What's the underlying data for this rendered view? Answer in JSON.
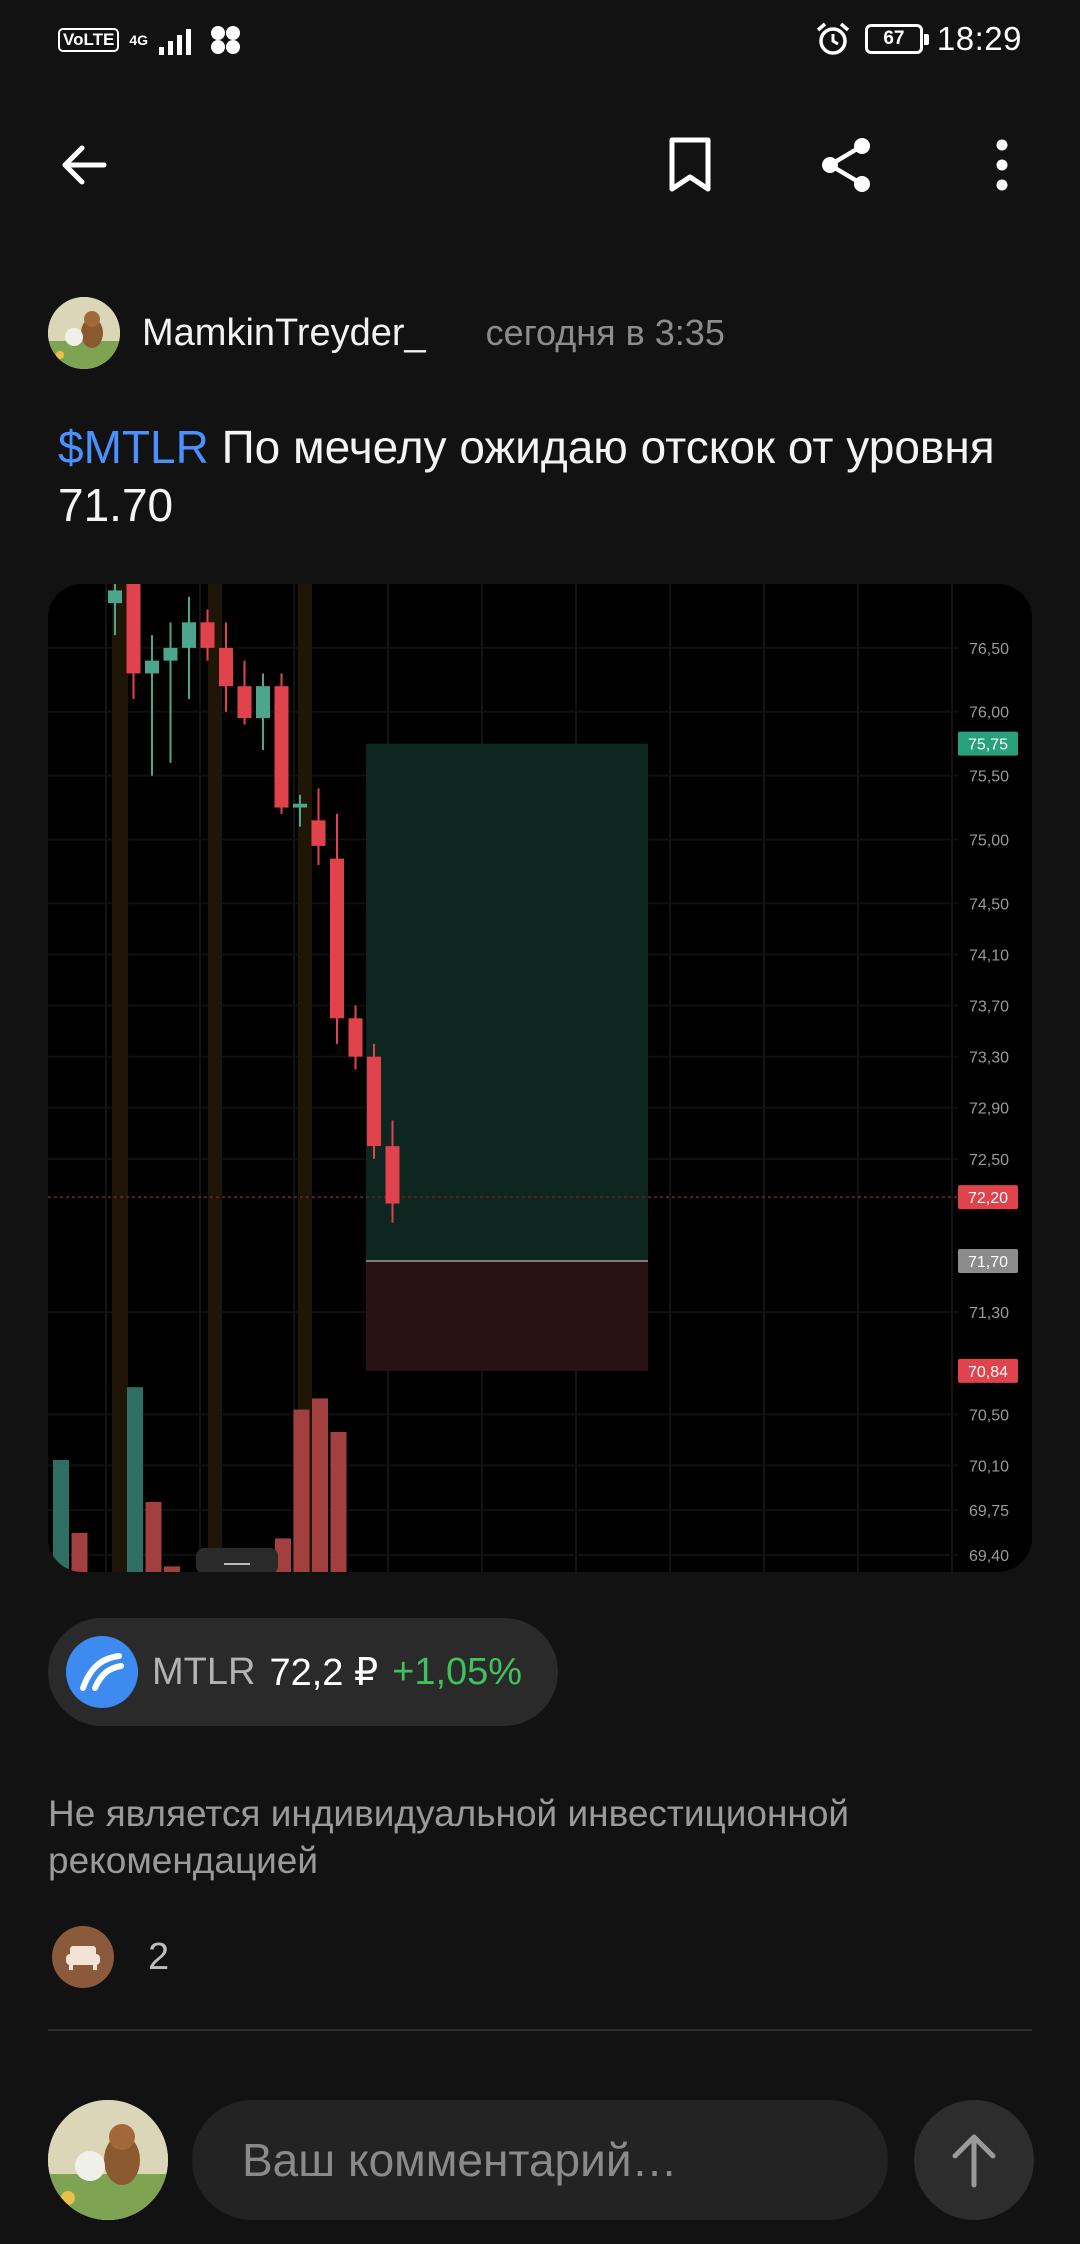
{
  "status_bar": {
    "volte": "VoLTE",
    "network": "4G",
    "battery": "67",
    "time": "18:29"
  },
  "icons": {
    "back": "arrow-left-icon",
    "bookmark": "bookmark-icon",
    "share": "share-icon",
    "more": "more-vertical-icon",
    "send": "arrow-up-icon"
  },
  "post": {
    "author": "MamkinTreyder_",
    "time": "сегодня в 3:35",
    "ticker_link": "$MTLR",
    "text": " По мечелу ожидаю отскок от уровня 71.70",
    "disclaimer": "Не является индивидуальной инвестиционной рекомендацией",
    "reaction_count": "2"
  },
  "instrument": {
    "ticker": "MTLR",
    "price": "72,2 ₽",
    "change": "+1,05%",
    "change_color": "#3fc15c"
  },
  "chart_data": {
    "type": "candlestick",
    "ylim": [
      69.25,
      77.0
    ],
    "y_ticks": [
      "76,50",
      "76,00",
      "75,50",
      "75,00",
      "74,50",
      "74,10",
      "73,70",
      "73,30",
      "72,90",
      "72,50",
      "71,30",
      "70,50",
      "70,10",
      "69,75",
      "69,40"
    ],
    "price_tags": [
      {
        "label": "75,75",
        "value": 75.75,
        "color": "#26a17b"
      },
      {
        "label": "72,20",
        "value": 72.2,
        "color": "#e0434b"
      },
      {
        "label": "71,70",
        "value": 71.7,
        "color": "#8c8c8c"
      },
      {
        "label": "70,84",
        "value": 70.84,
        "color": "#e0434b"
      }
    ],
    "candles": [
      {
        "o": 76.85,
        "h": 77.0,
        "l": 76.6,
        "c": 76.95
      },
      {
        "o": 77.2,
        "h": 77.2,
        "l": 76.1,
        "c": 76.3
      },
      {
        "o": 76.3,
        "h": 76.6,
        "l": 75.5,
        "c": 76.4
      },
      {
        "o": 76.4,
        "h": 76.7,
        "l": 75.6,
        "c": 76.5
      },
      {
        "o": 76.5,
        "h": 76.9,
        "l": 76.1,
        "c": 76.7
      },
      {
        "o": 76.7,
        "h": 76.8,
        "l": 76.4,
        "c": 76.5
      },
      {
        "o": 76.5,
        "h": 76.7,
        "l": 76.0,
        "c": 76.2
      },
      {
        "o": 76.2,
        "h": 76.4,
        "l": 75.9,
        "c": 75.95
      },
      {
        "o": 75.95,
        "h": 76.3,
        "l": 75.7,
        "c": 76.2
      },
      {
        "o": 76.2,
        "h": 76.3,
        "l": 75.2,
        "c": 75.25
      },
      {
        "o": 75.25,
        "h": 75.35,
        "l": 75.1,
        "c": 75.28
      },
      {
        "o": 75.15,
        "h": 75.4,
        "l": 74.8,
        "c": 74.95
      },
      {
        "o": 74.85,
        "h": 75.2,
        "l": 73.4,
        "c": 73.6
      },
      {
        "o": 73.6,
        "h": 73.7,
        "l": 73.2,
        "c": 73.3
      },
      {
        "o": 73.3,
        "h": 73.4,
        "l": 72.5,
        "c": 72.6
      },
      {
        "o": 72.6,
        "h": 72.8,
        "l": 72.0,
        "c": 72.15
      }
    ],
    "volume": [
      0.4,
      0.14,
      0,
      0,
      0.66,
      0.25,
      0.02,
      0,
      0,
      0.05,
      0.03,
      0.02,
      0.12,
      0.58,
      0.62,
      0.5
    ],
    "position": {
      "entry": 71.7,
      "target": 75.75,
      "stop": 70.84
    }
  }
}
